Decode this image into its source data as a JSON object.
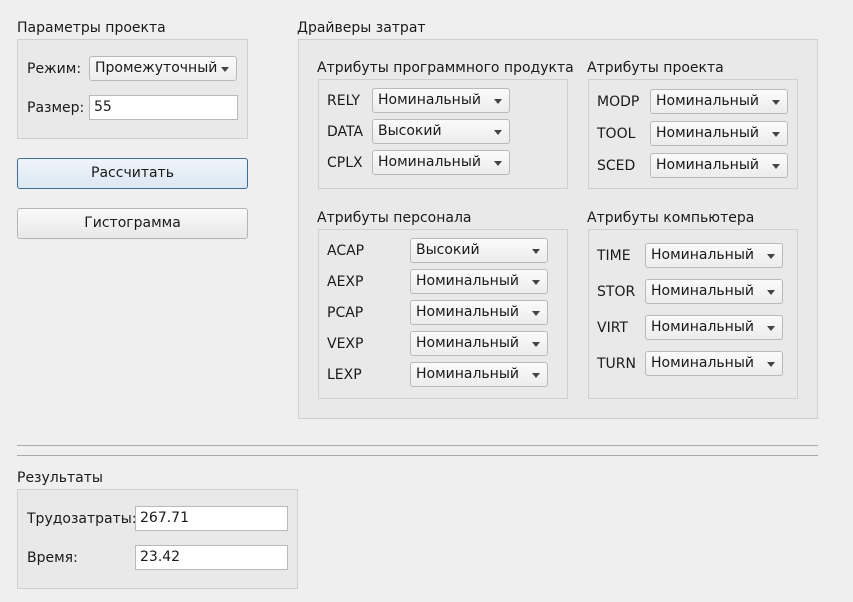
{
  "project_params": {
    "title": "Параметры проекта",
    "mode_label": "Режим:",
    "mode_value": "Промежуточный",
    "size_label": "Размер:",
    "size_value": "55"
  },
  "buttons": {
    "calculate": "Рассчитать",
    "histogram": "Гистограмма"
  },
  "cost_drivers": {
    "title": "Драйверы затрат",
    "product": {
      "title": "Атрибуты программного продукта",
      "items": [
        {
          "label": "RELY",
          "value": "Номинальный"
        },
        {
          "label": "DATA",
          "value": "Высокий"
        },
        {
          "label": "CPLX",
          "value": "Номинальный"
        }
      ]
    },
    "project": {
      "title": "Атрибуты проекта",
      "items": [
        {
          "label": "MODP",
          "value": "Номинальный"
        },
        {
          "label": "TOOL",
          "value": "Номинальный"
        },
        {
          "label": "SCED",
          "value": "Номинальный"
        }
      ]
    },
    "personnel": {
      "title": "Атрибуты персонала",
      "items": [
        {
          "label": "ACAP",
          "value": "Высокий"
        },
        {
          "label": "AEXP",
          "value": "Номинальный"
        },
        {
          "label": "PCAP",
          "value": "Номинальный"
        },
        {
          "label": "VEXP",
          "value": "Номинальный"
        },
        {
          "label": "LEXP",
          "value": "Номинальный"
        }
      ]
    },
    "computer": {
      "title": "Атрибуты компьютера",
      "items": [
        {
          "label": "TIME",
          "value": "Номинальный"
        },
        {
          "label": "STOR",
          "value": "Номинальный"
        },
        {
          "label": "VIRT",
          "value": "Номинальный"
        },
        {
          "label": "TURN",
          "value": "Номинальный"
        }
      ]
    }
  },
  "results": {
    "title": "Результаты",
    "effort_label": "Трудозатраты:",
    "effort_value": "267.71",
    "time_label": "Время:",
    "time_value": "23.42"
  }
}
